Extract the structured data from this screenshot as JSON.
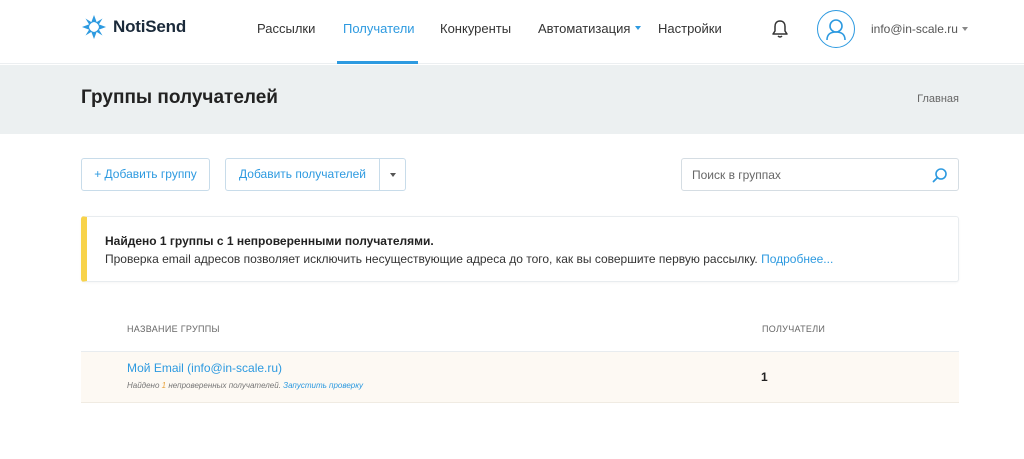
{
  "header": {
    "logo_text": "NotiSend",
    "nav": [
      {
        "label": "Рассылки"
      },
      {
        "label": "Получатели"
      },
      {
        "label": "Конкуренты"
      },
      {
        "label": "Автоматизация"
      },
      {
        "label": "Настройки"
      }
    ],
    "active_nav": "Получатели",
    "user_email": "info@in-scale.ru",
    "icons": [
      "notisend-logo-icon",
      "bell-icon",
      "user-avatar-icon",
      "chevron-down-icon"
    ]
  },
  "page": {
    "title": "Группы получателей",
    "breadcrumb": "Главная"
  },
  "toolbar": {
    "add_group_label": "+ Добавить группу",
    "add_recipients_label": "Добавить получателей",
    "search_placeholder": "Поиск в группах"
  },
  "alert": {
    "title": "Найдено 1 группы с 1 непроверенными получателями.",
    "text": "Проверка email адресов позволяет исключить несуществующие адреса до того, как вы совершите первую рассылку.",
    "link": "Подробнее..."
  },
  "table": {
    "columns": [
      "НАЗВАНИЕ ГРУППЫ",
      "ПОЛУЧАТЕЛИ"
    ],
    "rows": [
      {
        "name": "Мой Email (info@in-scale.ru)",
        "sub_prefix": "Найдено",
        "sub_count": "1",
        "sub_suffix": "непроверенных получателей.",
        "sub_link": "Запустить проверку",
        "recipients": "1"
      }
    ]
  },
  "colors": {
    "accent": "#2d9ae0",
    "alert_border": "#f8d34a",
    "band_bg": "#ecf0f1",
    "row_bg": "#fdf9f3"
  }
}
